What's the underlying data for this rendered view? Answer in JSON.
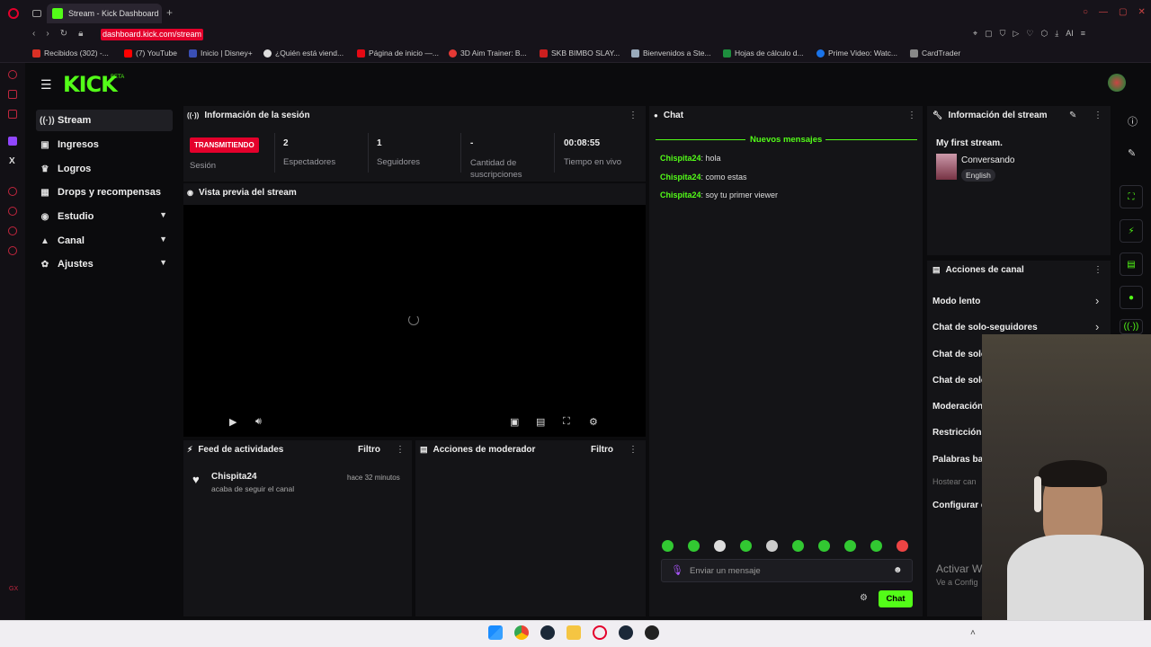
{
  "browser": {
    "tab_title": "Stream - Kick Dashboard",
    "url": "dashboard.kick.com/stream",
    "ai_label": "AI",
    "bookmarks": [
      "Recibidos (302) -...",
      "(7) YouTube",
      "Inicio | Disney+",
      "¿Quién está viend...",
      "Página de inicio —...",
      "3D Aim Trainer: B...",
      "SKB BIMBO SLAY...",
      "Bienvenidos a Ste...",
      "Hojas de cálculo d...",
      "Prime Video: Watc...",
      "CardTrader"
    ]
  },
  "brand": {
    "logo": "KICK",
    "beta": "BETA"
  },
  "sidebar": {
    "items": [
      {
        "label": "Stream",
        "icon": "broadcast-icon"
      },
      {
        "label": "Ingresos",
        "icon": "money-icon"
      },
      {
        "label": "Logros",
        "icon": "trophy-icon"
      },
      {
        "label": "Drops y recompensas",
        "icon": "gift-icon"
      },
      {
        "label": "Estudio",
        "icon": "studio-icon"
      },
      {
        "label": "Canal",
        "icon": "channel-icon"
      },
      {
        "label": "Ajustes",
        "icon": "gear-icon"
      }
    ]
  },
  "session": {
    "title": "Información de la sesión",
    "badge": "TRANSMITIENDO",
    "session_label": "Sesión",
    "viewers_value": "2",
    "viewers_label": "Espectadores",
    "followers_value": "1",
    "followers_label": "Seguidores",
    "subs_value": "-",
    "subs_label": "Cantidad de suscripciones",
    "time_value": "00:08:55",
    "time_label": "Tiempo en vivo"
  },
  "preview": {
    "title": "Vista previa del stream"
  },
  "activity": {
    "title": "Feed de actividades",
    "filter": "Filtro",
    "items": [
      {
        "user": "Chispita24",
        "text": "acaba de seguir el canal",
        "time": "hace 32 minutos"
      }
    ]
  },
  "mod": {
    "title": "Acciones de moderador",
    "filter": "Filtro"
  },
  "chat": {
    "title": "Chat",
    "new_messages": "Nuevos mensajes",
    "messages": [
      {
        "user": "Chispita24",
        "text": "hola"
      },
      {
        "user": "Chispita24",
        "text": "como estas"
      },
      {
        "user": "Chispita24",
        "text": "soy tu primer viewer"
      }
    ],
    "placeholder": "Enviar un mensaje",
    "send_label": "Chat"
  },
  "stream_info": {
    "title": "Información del stream",
    "stream_title": "My first stream.",
    "category": "Conversando",
    "language": "English"
  },
  "channel_actions": {
    "title": "Acciones de canal",
    "items": [
      "Modo lento",
      "Chat de solo-seguidores",
      "Chat de solo",
      "Chat de solo",
      "Moderación",
      "Restricción",
      "Palabras ba",
      "Hostear can",
      "Configurar c"
    ]
  },
  "windows_watermark": {
    "line1": "Activar W",
    "line2": "Ve a Config"
  },
  "colors": {
    "accent": "#53fc18",
    "live": "#e4002b",
    "panel": "#141417",
    "bg": "#0b0b0d"
  }
}
